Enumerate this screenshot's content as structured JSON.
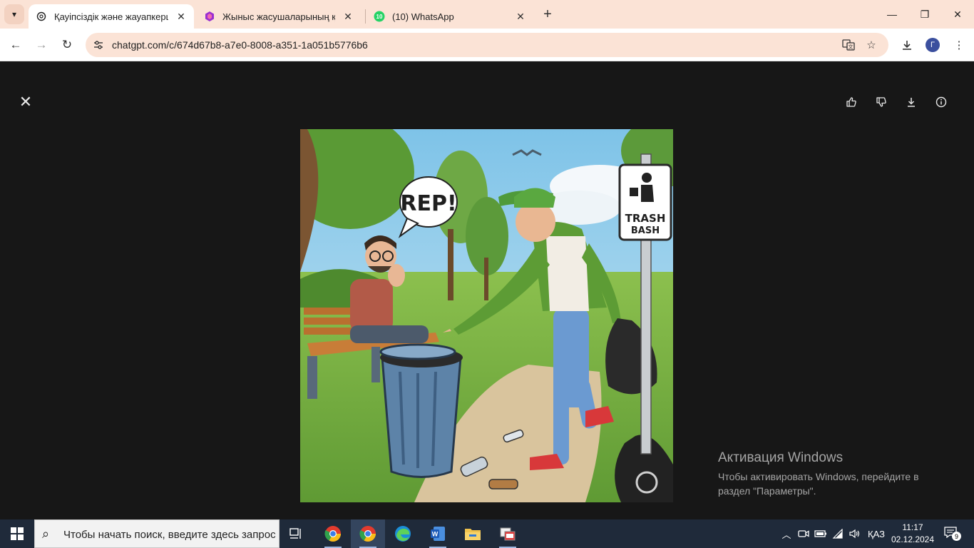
{
  "browser": {
    "tabs": [
      {
        "title": "Қауіпсіздік және жауапкершілік",
        "favicon": "chatgpt-icon",
        "active": true
      },
      {
        "title": "Жыныс жасушаларының қалыптасуы",
        "favicon": "app-icon",
        "active": false
      },
      {
        "title": "(10) WhatsApp",
        "favicon": "whatsapp-icon",
        "badge": "10",
        "active": false
      }
    ],
    "url": "chatgpt.com/c/674d67b8-a7e0-8008-a351-1a051b5776b6",
    "profile_initial": "Г"
  },
  "viewer": {
    "actions": [
      "thumbs-up-icon",
      "thumbs-down-icon",
      "download-icon",
      "info-icon"
    ],
    "image": {
      "speech_bubble": "REP!",
      "sign_line1": "TRASH",
      "sign_line2": "BASH"
    }
  },
  "watermark": {
    "title": "Активация Windows",
    "subtitle": "Чтобы активировать Windows, перейдите в раздел \"Параметры\"."
  },
  "taskbar": {
    "search_placeholder": "Чтобы начать поиск, введите здесь запрос",
    "language": "ҚАЗ",
    "time": "11:17",
    "date": "02.12.2024",
    "notifications": "9"
  }
}
